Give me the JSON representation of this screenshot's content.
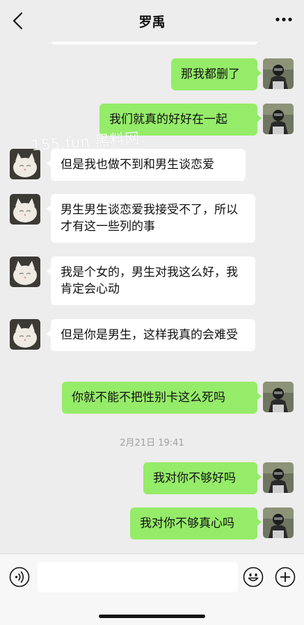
{
  "header": {
    "title": "罗禹"
  },
  "watermark": "155.fun 黑料网",
  "messages": [
    {
      "side": "out",
      "text": "那我都删了"
    },
    {
      "side": "out",
      "text": "我们就真的好好在一起"
    },
    {
      "side": "in",
      "text": "但是我也做不到和男生谈恋爱"
    },
    {
      "side": "in",
      "text": "男生男生谈恋爱我接受不了，所以才有这一些列的事"
    },
    {
      "side": "in",
      "text": "我是个女的，男生对我这么好，我肯定会心动"
    },
    {
      "side": "in",
      "text": "但是你是男生，这样我真的会难受"
    },
    {
      "side": "out",
      "text": "你就不能不把性别卡这么死吗"
    },
    {
      "side": "out",
      "text": "我对你不够好吗"
    },
    {
      "side": "out",
      "text": "我对你不够真心吗"
    }
  ],
  "timestamp": "2月21日 19:41",
  "input": {
    "value": ""
  },
  "colors": {
    "background": "#ededed",
    "outgoing_bubble": "#95ec69",
    "incoming_bubble": "#ffffff"
  }
}
